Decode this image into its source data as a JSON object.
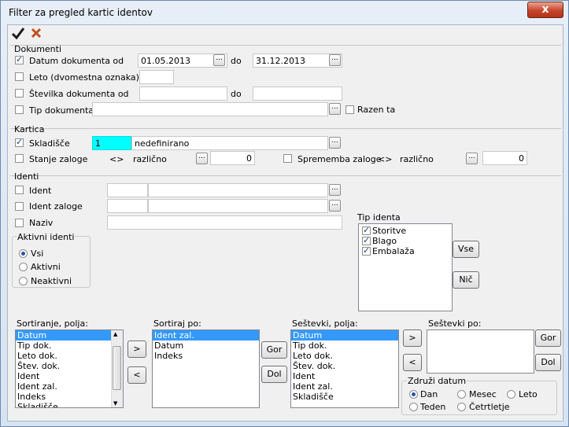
{
  "window": {
    "title": "Filter za pregled kartic identov",
    "close": "x"
  },
  "toolbar": {
    "ok_icon": "check-icon",
    "cancel_icon": "cross-icon"
  },
  "dokumenti": {
    "group": "Dokumenti",
    "datum_label": "Datum dokumenta od",
    "datum_checked": true,
    "datum_od": "01.05.2013",
    "do1": "do",
    "datum_do": "31.12.2013",
    "leto_label": "Leto (dvomestna oznaka)",
    "leto_value": "",
    "stevilka_label": "Številka dokumenta od",
    "stevilka_od": "",
    "do2": "do",
    "stevilka_do": "",
    "tip_label": "Tip dokumenta",
    "tip_value": "",
    "razen_label": "Razen ta"
  },
  "kartica": {
    "group": "Kartica",
    "skladisce_label": "Skladišče",
    "skladisce_checked": true,
    "skladisce_value": "1",
    "skladisce_text": "nedefinirano",
    "stanje_label": "Stanje zaloge",
    "stanje_op": "<>",
    "stanje_op_text": "različno",
    "stanje_value": "0",
    "sprememba_label": "Sprememba zaloge",
    "sprememba_op": "<>",
    "sprememba_op_text": "različno",
    "sprememba_value": "0"
  },
  "identi": {
    "group": "Identi",
    "ident_label": "Ident",
    "ident_zaloge_label": "Ident zaloge",
    "naziv_label": "Naziv",
    "aktivni_group": "Aktivni identi",
    "aktivni_options": [
      "Vsi",
      "Aktivni",
      "Neaktivni"
    ],
    "aktivni_selected": 0,
    "tip_group": "Tip identa",
    "tip_items": [
      "Storitve",
      "Blago",
      "Embalaža"
    ],
    "vse_button": "Vse",
    "nic_button": "Nič"
  },
  "sort": {
    "polja_label": "Sortiranje, polja:",
    "polja_items": [
      "Datum",
      "Tip dok.",
      "Leto dok.",
      "Štev. dok.",
      "Ident",
      "Ident zal.",
      "Indeks",
      "Skladišče"
    ],
    "po_label": "Sortiraj po:",
    "po_items": [
      "Ident zal.",
      "Datum",
      "Indeks"
    ],
    "move_right": ">",
    "move_left": "<",
    "gor": "Gor",
    "dol": "Dol"
  },
  "sestevki": {
    "polja_label": "Seštevki, polja:",
    "polja_items": [
      "Datum",
      "Tip dok.",
      "Leto dok.",
      "Štev. dok.",
      "Ident",
      "Ident zal.",
      "Skladišče"
    ],
    "po_label": "Seštevki po:",
    "move_right": ">",
    "move_left": "<",
    "gor": "Gor",
    "dol": "Dol"
  },
  "zdruzi": {
    "group": "Združi datum",
    "options": [
      "Dan",
      "Mesec",
      "Leto",
      "Teden",
      "Četrtletje"
    ],
    "selected": 0
  }
}
